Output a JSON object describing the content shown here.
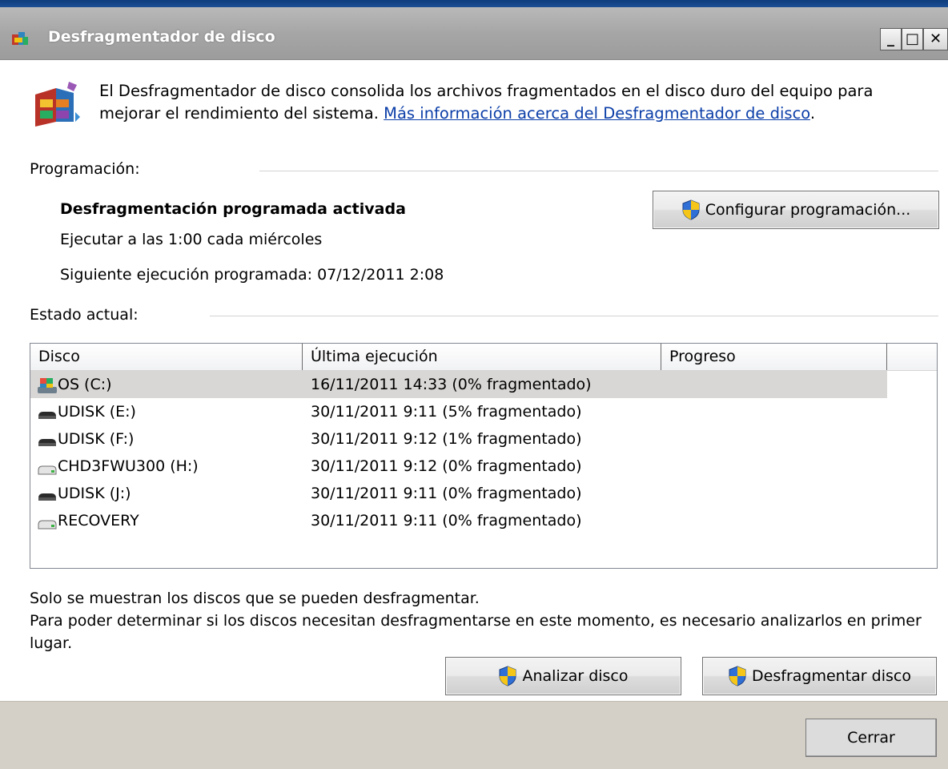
{
  "window": {
    "title": "Desfragmentador de disco",
    "min_symbol": "_",
    "max_symbol": "□",
    "close_symbol": "✕"
  },
  "intro": {
    "text": "El Desfragmentador de disco consolida los archivos fragmentados en el disco duro del equipo para mejorar el rendimiento del sistema. ",
    "link": "Más información acerca del Desfragmentador de disco",
    "after_link": "."
  },
  "schedule": {
    "section_label": "Programación:",
    "status": "Desfragmentación programada activada",
    "run_at": "Ejecutar a las 1:00 cada miércoles",
    "next_run": "Siguiente ejecución programada: 07/12/2011 2:08",
    "configure_button": "Configurar programación..."
  },
  "status": {
    "section_label": "Estado actual:",
    "columns": [
      "Disco",
      "Última ejecución",
      "Progreso"
    ],
    "disks": [
      {
        "name": "OS (C:)",
        "last_run": "16/11/2011 14:33 (0% fragmentado)",
        "icon": "system-drive-icon",
        "selected": true
      },
      {
        "name": "UDISK (E:)",
        "last_run": "30/11/2011 9:11 (5% fragmentado)",
        "icon": "removable-drive-icon",
        "selected": false
      },
      {
        "name": "UDISK (F:)",
        "last_run": "30/11/2011 9:12 (1% fragmentado)",
        "icon": "removable-drive-icon",
        "selected": false
      },
      {
        "name": "CHD3FWU300 (H:)",
        "last_run": "30/11/2011 9:12 (0% fragmentado)",
        "icon": "hard-drive-icon",
        "selected": false
      },
      {
        "name": "UDISK (J:)",
        "last_run": "30/11/2011 9:11 (0% fragmentado)",
        "icon": "removable-drive-icon",
        "selected": false
      },
      {
        "name": "RECOVERY",
        "last_run": "30/11/2011 9:11 (0% fragmentado)",
        "icon": "hard-drive-icon",
        "selected": false
      }
    ]
  },
  "notes": {
    "line1": "Solo se muestran los discos que se pueden desfragmentar.",
    "line2": "Para poder determinar si los discos necesitan desfragmentarse en este momento, es necesario analizarlos en primer",
    "line3": "lugar."
  },
  "actions": {
    "analyze_button": "Analizar disco",
    "defrag_button": "Desfragmentar disco",
    "close_button": "Cerrar"
  },
  "colors": {
    "link": "#0b3ea8",
    "selected_row": "#d9d7d5",
    "footer": "#d4d0c8"
  }
}
